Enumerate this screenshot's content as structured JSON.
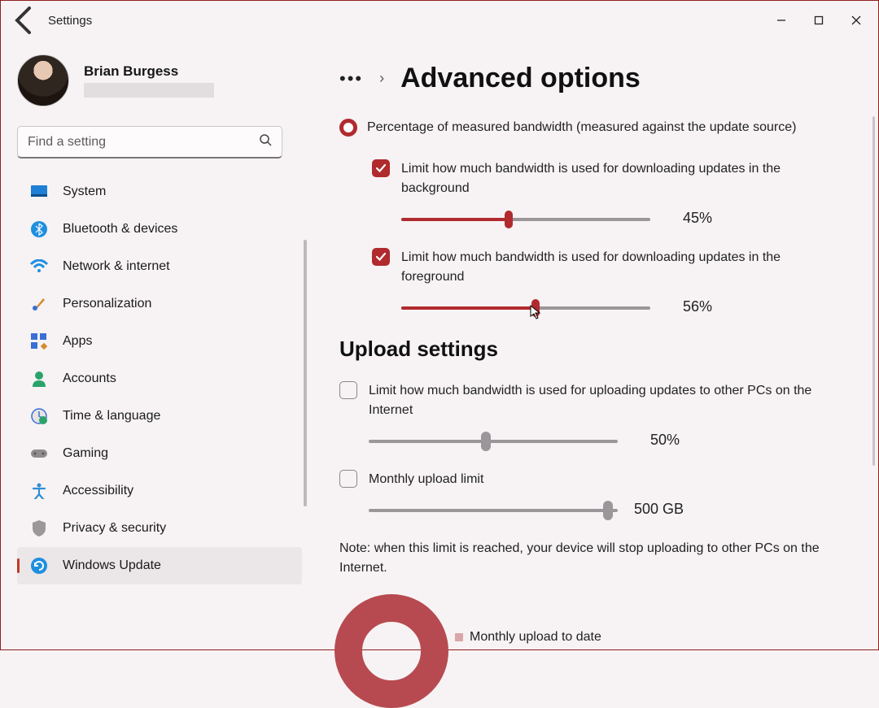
{
  "app": {
    "title": "Settings"
  },
  "user": {
    "name": "Brian Burgess"
  },
  "search": {
    "placeholder": "Find a setting"
  },
  "sidebar": {
    "items": [
      {
        "label": "System"
      },
      {
        "label": "Bluetooth & devices"
      },
      {
        "label": "Network & internet"
      },
      {
        "label": "Personalization"
      },
      {
        "label": "Apps"
      },
      {
        "label": "Accounts"
      },
      {
        "label": "Time & language"
      },
      {
        "label": "Gaming"
      },
      {
        "label": "Accessibility"
      },
      {
        "label": "Privacy & security"
      },
      {
        "label": "Windows Update"
      }
    ]
  },
  "page": {
    "title": "Advanced options",
    "radio1": "Percentage of measured bandwidth (measured against the update source)",
    "opt1": "Limit how much bandwidth is used for downloading updates in the background",
    "val1": "45%",
    "pct1": 43,
    "opt2": "Limit how much bandwidth is used for downloading updates in the foreground",
    "val2": "56%",
    "pct2": 54,
    "upload_title": "Upload settings",
    "opt3": "Limit how much bandwidth is used for uploading updates to other PCs on the Internet",
    "val3": "50%",
    "pct3": 47,
    "opt4": "Monthly upload limit",
    "val4": "500 GB",
    "pct4": 96,
    "note": "Note: when this limit is reached, your device will stop uploading to other PCs on the Internet.",
    "summary_label": "Monthly upload to date"
  },
  "colors": {
    "accent": "#b02a2e"
  }
}
